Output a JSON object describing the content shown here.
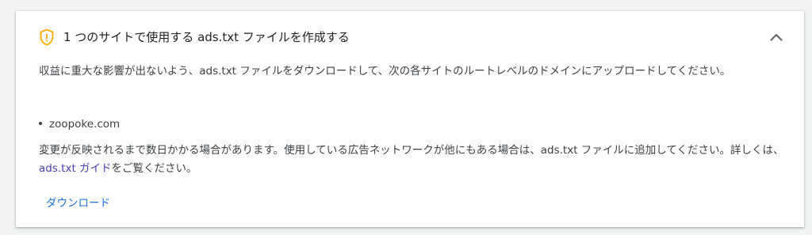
{
  "card": {
    "title": "1 つのサイトで使用する ads.txt ファイルを作成する",
    "icons": {
      "warning": "shield-warning-icon",
      "collapse": "chevron-up-icon"
    },
    "intro": "収益に重大な影響が出ないよう、ads.txt ファイルをダウンロードして、次の各サイトのルートレベルのドメインにアップロードしてください。",
    "sites": [
      "zoopoke.com"
    ],
    "note_before_link": "変更が反映されるまで数日かかる場合があります。使用している広告ネットワークが他にもある場合は、ads.txt ファイルに追加してください。詳しくは、",
    "note_link": "ads.txt ガイド",
    "note_after_link": "をご覧ください。",
    "download_label": "ダウンロード"
  },
  "colors": {
    "warning": "#f9ab00",
    "link": "#4b3fb5",
    "button_text": "#1a73e8"
  }
}
